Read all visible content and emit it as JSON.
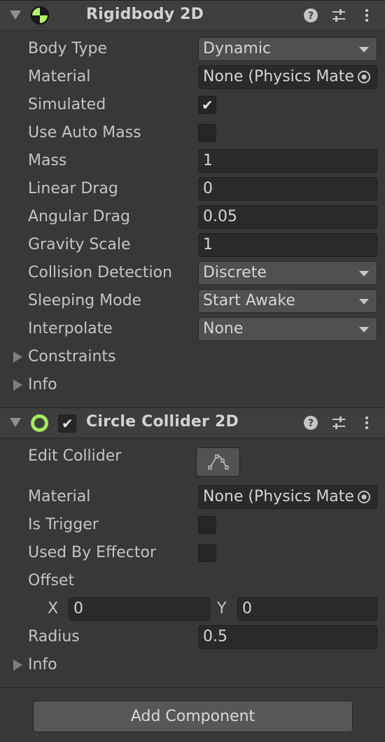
{
  "rigidbody": {
    "title": "Rigidbody 2D",
    "fields": {
      "body_type": {
        "label": "Body Type",
        "value": "Dynamic"
      },
      "material": {
        "label": "Material",
        "value": "None (Physics Mate"
      },
      "simulated": {
        "label": "Simulated",
        "checked": true
      },
      "use_auto_mass": {
        "label": "Use Auto Mass",
        "checked": false
      },
      "mass": {
        "label": "Mass",
        "value": "1"
      },
      "linear_drag": {
        "label": "Linear Drag",
        "value": "0"
      },
      "angular_drag": {
        "label": "Angular Drag",
        "value": "0.05"
      },
      "gravity_scale": {
        "label": "Gravity Scale",
        "value": "1"
      },
      "collision_detection": {
        "label": "Collision Detection",
        "value": "Discrete"
      },
      "sleeping_mode": {
        "label": "Sleeping Mode",
        "value": "Start Awake"
      },
      "interpolate": {
        "label": "Interpolate",
        "value": "None"
      }
    },
    "foldouts": {
      "constraints": "Constraints",
      "info": "Info"
    }
  },
  "circle_collider": {
    "title": "Circle Collider 2D",
    "enabled": true,
    "fields": {
      "edit_collider": {
        "label": "Edit Collider"
      },
      "material": {
        "label": "Material",
        "value": "None (Physics Mate"
      },
      "is_trigger": {
        "label": "Is Trigger",
        "checked": false
      },
      "used_by_effector": {
        "label": "Used By Effector",
        "checked": false
      },
      "offset": {
        "label": "Offset",
        "x_label": "X",
        "x_value": "0",
        "y_label": "Y",
        "y_value": "0"
      },
      "radius": {
        "label": "Radius",
        "value": "0.5"
      }
    },
    "foldouts": {
      "info": "Info"
    }
  },
  "add_component": {
    "label": "Add Component"
  },
  "colors": {
    "panel_bg": "#383838",
    "header_bg": "#3e3e3e",
    "field_bg": "#2a2a2a",
    "dropdown_bg": "#505050",
    "rigidbody_icon": "#b6f26a",
    "collider_icon": "#a4ea5c"
  },
  "icons": {
    "header": [
      "help-icon",
      "preset-sliders-icon",
      "context-menu-kebab-icon"
    ],
    "object_picker": "object-picker-icon",
    "edit_collider": "edit-collider-shape-icon"
  }
}
